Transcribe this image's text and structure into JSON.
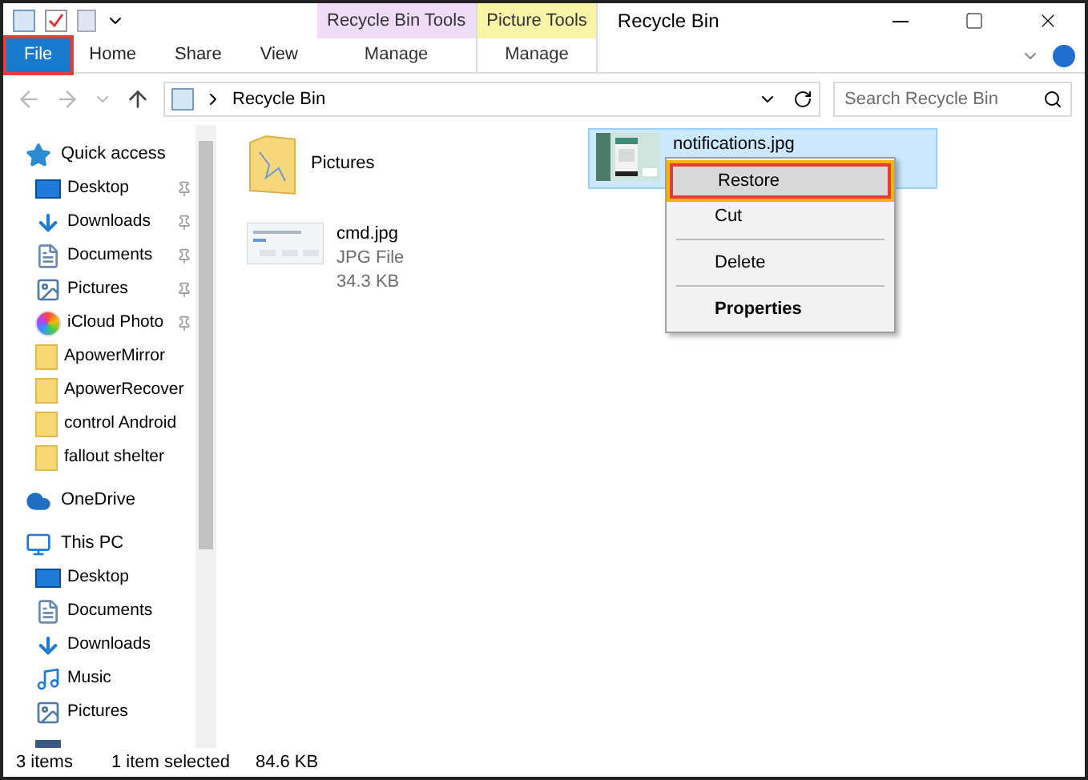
{
  "window": {
    "title": "Recycle Bin"
  },
  "context_groups": [
    {
      "label": "Recycle Bin Tools",
      "color": "#efdcf7",
      "tab": "Manage"
    },
    {
      "label": "Picture Tools",
      "color": "#f8f5a8",
      "tab": "Manage"
    }
  ],
  "ribbon_tabs": [
    {
      "label": "File",
      "kind": "file",
      "highlighted": true
    },
    {
      "label": "Home",
      "kind": "tab",
      "highlighted": false
    },
    {
      "label": "Share",
      "kind": "tab",
      "highlighted": false
    },
    {
      "label": "View",
      "kind": "tab",
      "highlighted": false
    }
  ],
  "address": {
    "path": "Recycle Bin"
  },
  "search": {
    "placeholder": "Search Recycle Bin"
  },
  "sidebar": {
    "items": [
      {
        "label": "Quick access",
        "kind": "star",
        "children": [
          {
            "label": "Desktop",
            "kind": "desktop",
            "pinned": true
          },
          {
            "label": "Downloads",
            "kind": "download",
            "pinned": true
          },
          {
            "label": "Documents",
            "kind": "document",
            "pinned": true
          },
          {
            "label": "Pictures",
            "kind": "pictures",
            "pinned": true
          },
          {
            "label": "iCloud Photo",
            "kind": "photos",
            "pinned": true
          },
          {
            "label": "ApowerMirror",
            "kind": "folder",
            "pinned": false
          },
          {
            "label": "ApowerRecover",
            "kind": "folder",
            "pinned": false
          },
          {
            "label": "control Android",
            "kind": "folder",
            "pinned": false
          },
          {
            "label": "fallout shelter",
            "kind": "folder",
            "pinned": false
          }
        ]
      },
      {
        "label": "OneDrive",
        "kind": "cloud"
      },
      {
        "label": "This PC",
        "kind": "pc",
        "children": [
          {
            "label": "Desktop",
            "kind": "desktop"
          },
          {
            "label": "Documents",
            "kind": "document"
          },
          {
            "label": "Downloads",
            "kind": "download"
          },
          {
            "label": "Music",
            "kind": "music"
          },
          {
            "label": "Pictures",
            "kind": "pictures"
          },
          {
            "kind": "video"
          }
        ]
      }
    ]
  },
  "files": [
    {
      "name": "Pictures",
      "kind": "folder",
      "selected": false
    },
    {
      "name": "cmd.jpg",
      "selected": false,
      "details": [
        "JPG File",
        "34.3 KB"
      ]
    },
    {
      "name": "notifications.jpg",
      "selected": true
    }
  ],
  "context_menu": [
    {
      "label": "Restore",
      "kind": "normal",
      "selected": true,
      "highlighted": true,
      "separator_before": false
    },
    {
      "label": "Cut",
      "kind": "normal",
      "selected": false,
      "highlighted": false,
      "separator_before": false
    },
    {
      "label": "Delete",
      "kind": "normal",
      "selected": false,
      "highlighted": false,
      "separator_before": true
    },
    {
      "label": "Properties",
      "kind": "default",
      "selected": false,
      "highlighted": false,
      "separator_before": true
    }
  ],
  "status_bar": [
    "3 items",
    "1 item selected",
    "84.6 KB"
  ]
}
